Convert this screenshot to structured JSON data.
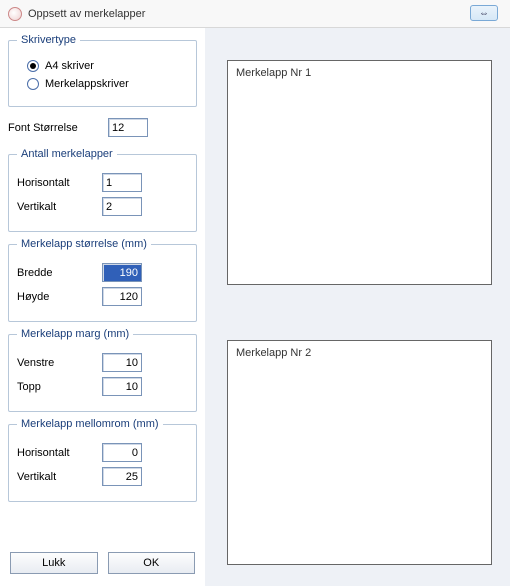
{
  "window": {
    "title": "Oppsett av merkelapper",
    "double_arrow_glyph": "⇔"
  },
  "printerType": {
    "legend": "Skrivertype",
    "options": {
      "a4": "A4 skriver",
      "labelPrinter": "Merkelappskriver"
    },
    "selected": "a4"
  },
  "fontSize": {
    "label": "Font Størrelse",
    "value": "12"
  },
  "labelCount": {
    "legend": "Antall merkelapper",
    "horizLabel": "Horisontalt",
    "vertLabel": "Vertikalt",
    "horiz": "1",
    "vert": "2"
  },
  "labelSize": {
    "legend": "Merkelapp størrelse (mm)",
    "widthLabel": "Bredde",
    "heightLabel": "Høyde",
    "width": "190",
    "height": "120"
  },
  "labelMargin": {
    "legend": "Merkelapp marg (mm)",
    "leftLabel": "Venstre",
    "topLabel": "Topp",
    "left": "10",
    "top": "10"
  },
  "labelSpacing": {
    "legend": "Merkelapp mellomrom (mm)",
    "horizLabel": "Horisontalt",
    "vertLabel": "Vertikalt",
    "horiz": "0",
    "vert": "25"
  },
  "buttons": {
    "close": "Lukk",
    "ok": "OK"
  },
  "preview": {
    "label1": "Merkelapp Nr 1",
    "label2": "Merkelapp Nr 2"
  }
}
